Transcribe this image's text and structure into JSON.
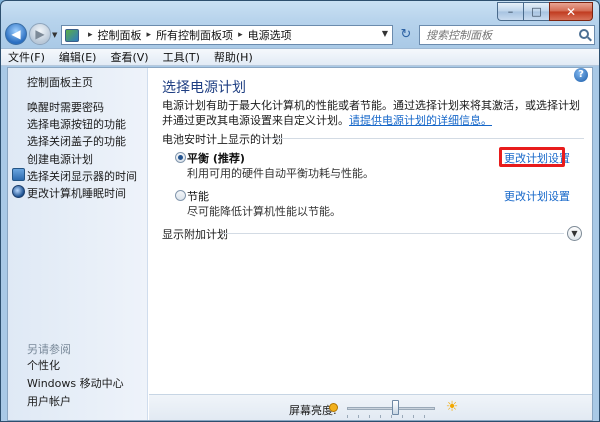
{
  "window": {
    "caption_min": "–",
    "caption_max": "□",
    "caption_close": "✕"
  },
  "nav": {
    "back_glyph": "◀",
    "fwd_glyph": "▶",
    "crumbs": [
      "控制面板",
      "所有控制面板项",
      "电源选项"
    ],
    "search_placeholder": "搜索控制面板"
  },
  "menubar": {
    "items": [
      "文件(F)",
      "编辑(E)",
      "查看(V)",
      "工具(T)",
      "帮助(H)"
    ]
  },
  "sidebar": {
    "home": "控制面板主页",
    "items": [
      "唤醒时需要密码",
      "选择电源按钮的功能",
      "选择关闭盖子的功能",
      "创建电源计划",
      "选择关闭显示器的时间",
      "更改计算机睡眠时间"
    ],
    "see_also_title": "另请参阅",
    "see_also": [
      "个性化",
      "Windows 移动中心",
      "用户帐户"
    ]
  },
  "main": {
    "title": "选择电源计划",
    "description": "电源计划有助于最大化计算机的性能或者节能。通过选择计划来将其激活，或选择计划并通过更改其电源设置来自定义计划。",
    "description_link": "请提供电源计划的详细信息。",
    "section_label": "电池安时计上显示的计划",
    "plans": [
      {
        "name": "平衡 (推荐)",
        "desc": "利用可用的硬件自动平衡功耗与性能。",
        "link": "更改计划设置",
        "selected": true
      },
      {
        "name": "节能",
        "desc": "尽可能降低计算机性能以节能。",
        "link": "更改计划设置",
        "selected": false
      }
    ],
    "additional_plans": "显示附加计划",
    "help_glyph": "?"
  },
  "bottom": {
    "brightness_label": "屏幕亮度:",
    "brightness_level": 0.55
  }
}
